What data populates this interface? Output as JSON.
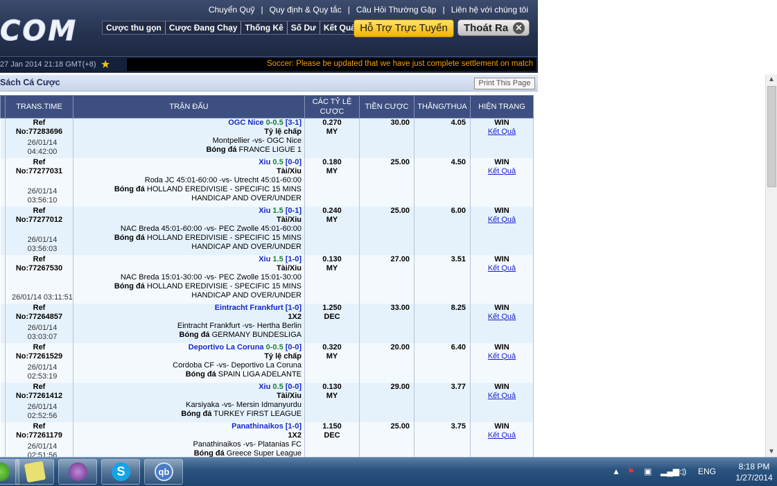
{
  "header": {
    "logo_text": "COM",
    "top_links": [
      "Chuyển Quỹ",
      "Quy định & Quy tắc",
      "Câu Hỏi Thường Gặp",
      "Liên hệ với chúng tôi"
    ],
    "tabs": [
      "Cược thu gọn",
      "Cược Đang Chạy",
      "Thống Kê",
      "Số Dư",
      "Kết Quả"
    ],
    "support_label": "Hỗ Trợ Trực Tuyến",
    "logout_label": "Thoát Ra",
    "logout_icon": "close-icon"
  },
  "ticker": {
    "datetime": "27 Jan 2014 21:18 GMT(+8)",
    "message": "Soccer: Please be updated that we have just complete settlement on match betv"
  },
  "page": {
    "title": "Sách Cá Cược",
    "print_label": "Print This Page"
  },
  "table": {
    "headers": [
      "TRANS.TIME",
      "TRẬN ĐẤU",
      "CÁC TỶ LỆ CƯỢC",
      "TIỀN CƯỢC",
      "THẮNG/THUA",
      "HIỆN TRẠNG"
    ],
    "rows": [
      {
        "ref": "Ref",
        "no": "No:77283696",
        "time": "26/01/14 04:42:00",
        "selection": "OGC Nice",
        "hdp": "0-0.5",
        "score": "[3-1]",
        "bet_type": "Tỷ lệ chấp",
        "match": "Montpellier -vs- OGC Nice",
        "sport": "Bóng đá",
        "league": "FRANCE LIGUE 1",
        "odds": "0.270",
        "odds_type": "MY",
        "stake": "30.00",
        "win": "4.05",
        "status": "WIN",
        "link": "Kết Quả"
      },
      {
        "ref": "Ref",
        "no": "No:77277031",
        "time": "26/01/14 03:56:10",
        "selection": "Xiu",
        "hdp": "0.5",
        "score": "[0-0]",
        "bet_type": "Tài/Xiu",
        "match": "Roda JC 45:01-60:00 -vs- Utrecht 45:01-60:00",
        "sport": "Bóng đá",
        "league": "HOLLAND EREDIVISIE - SPECIFIC 15 MINS HANDICAP AND OVER/UNDER",
        "odds": "0.180",
        "odds_type": "MY",
        "stake": "25.00",
        "win": "4.50",
        "status": "WIN",
        "link": "Kết Quả"
      },
      {
        "ref": "Ref",
        "no": "No:77277012",
        "time": "26/01/14 03:56:03",
        "selection": "Xiu",
        "hdp": "1.5",
        "score": "[0-1]",
        "bet_type": "Tài/Xiu",
        "match": "NAC Breda 45:01-60:00 -vs- PEC Zwolle 45:01-60:00",
        "sport": "Bóng đá",
        "league": "HOLLAND EREDIVISIE - SPECIFIC 15 MINS HANDICAP AND OVER/UNDER",
        "odds": "0.240",
        "odds_type": "MY",
        "stake": "25.00",
        "win": "6.00",
        "status": "WIN",
        "link": "Kết Quả"
      },
      {
        "ref": "Ref",
        "no": "No:77267530",
        "time": "26/01/14 03:11:51",
        "selection": "Xiu",
        "hdp": "1.5",
        "score": "[1-0]",
        "bet_type": "Tài/Xiu",
        "match": "NAC Breda 15:01-30:00 -vs- PEC Zwolle 15:01-30:00",
        "sport": "Bóng đá",
        "league": "HOLLAND EREDIVISIE - SPECIFIC 15 MINS HANDICAP AND OVER/UNDER",
        "odds": "0.130",
        "odds_type": "MY",
        "stake": "27.00",
        "win": "3.51",
        "status": "WIN",
        "link": "Kết Quả"
      },
      {
        "ref": "Ref",
        "no": "No:77264857",
        "time": "26/01/14 03:03:07",
        "selection": "Eintracht Frankfurt",
        "hdp": "",
        "score": "[1-0]",
        "bet_type": "1X2",
        "match": "Eintracht Frankfurt -vs- Hertha Berlin",
        "sport": "Bóng đá",
        "league": "GERMANY BUNDESLIGA",
        "odds": "1.250",
        "odds_type": "DEC",
        "stake": "33.00",
        "win": "8.25",
        "status": "WIN",
        "link": "Kết Quả"
      },
      {
        "ref": "Ref",
        "no": "No:77261529",
        "time": "26/01/14 02:53:19",
        "selection": "Deportivo La Coruna",
        "hdp": "0-0.5",
        "score": "[0-0]",
        "bet_type": "Tỷ lệ chấp",
        "match": "Cordoba CF -vs- Deportivo La Coruna",
        "sport": "Bóng đá",
        "league": "SPAIN LIGA ADELANTE",
        "odds": "0.320",
        "odds_type": "MY",
        "stake": "20.00",
        "win": "6.40",
        "status": "WIN",
        "link": "Kết Quả"
      },
      {
        "ref": "Ref",
        "no": "No:77261412",
        "time": "26/01/14 02:52:56",
        "selection": "Xiu",
        "hdp": "0.5",
        "score": "[0-0]",
        "bet_type": "Tài/Xiu",
        "match": "Karsiyaka -vs- Mersin Idmanyurdu",
        "sport": "Bóng đá",
        "league": "TURKEY FIRST LEAGUE",
        "odds": "0.130",
        "odds_type": "MY",
        "stake": "29.00",
        "win": "3.77",
        "status": "WIN",
        "link": "Kết Quả"
      },
      {
        "ref": "Ref",
        "no": "No:77261179",
        "time": "26/01/14 02:51:56",
        "selection": "Panathinaikos",
        "hdp": "",
        "score": "[1-0]",
        "bet_type": "1X2",
        "match": "Panathinaikos -vs- Platanias FC",
        "sport": "Bóng đá",
        "league": "Greece Super League",
        "odds": "1.150",
        "odds_type": "DEC",
        "stake": "25.00",
        "win": "3.75",
        "status": "WIN",
        "link": "Kết Quả"
      }
    ]
  },
  "taskbar": {
    "apps": [
      "start-orb",
      "sticky-notes",
      "messenger",
      "skype",
      "qbittorrent"
    ],
    "app_labels": {
      "skype": "S",
      "qbittorrent": "qb"
    },
    "language": "ENG",
    "time": "8:18 PM",
    "date": "1/27/2014"
  }
}
